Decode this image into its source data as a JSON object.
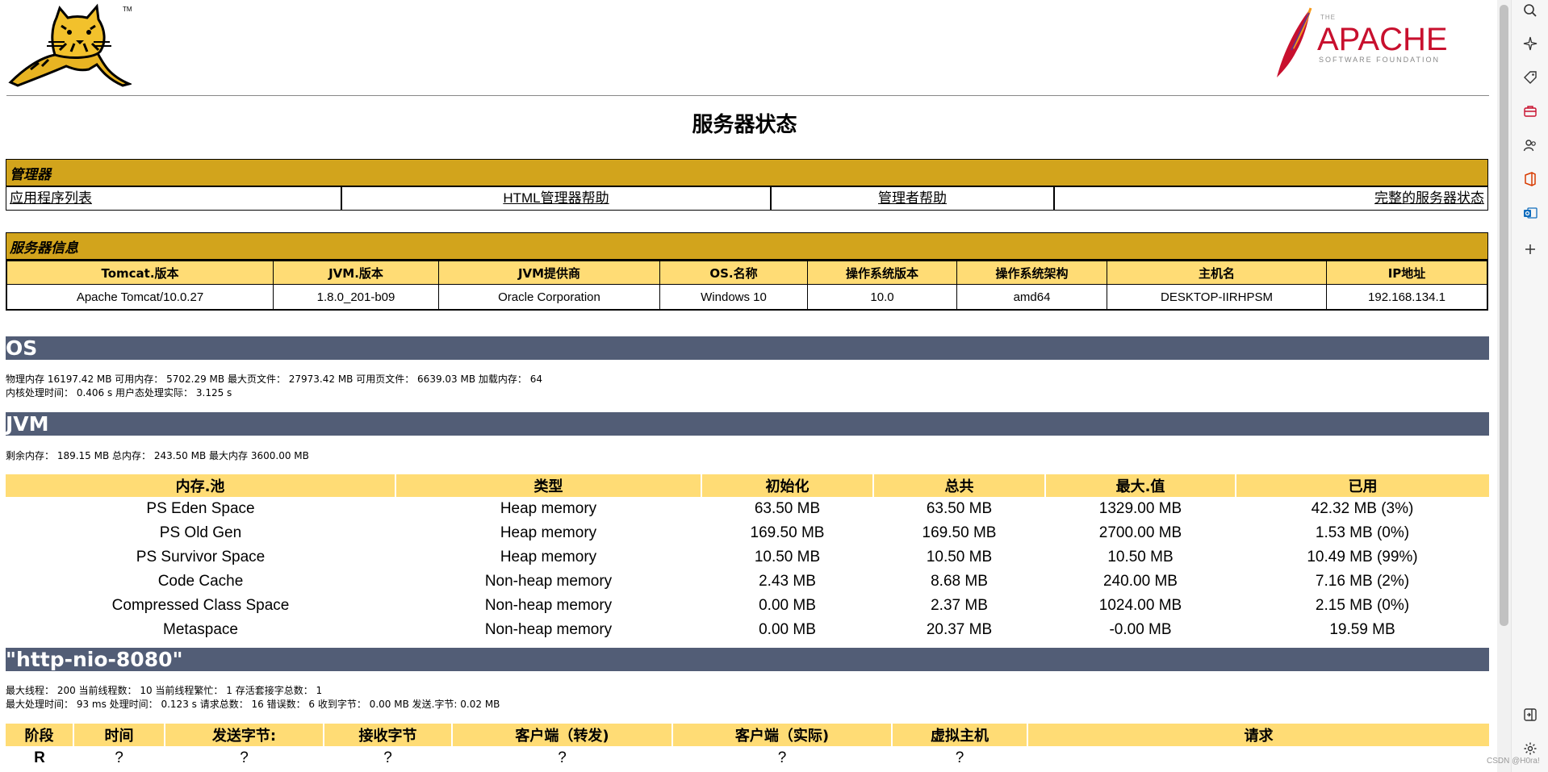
{
  "page_title": "服务器状态",
  "logos": {
    "apache_the": "THE",
    "apache_name": "APACHE",
    "apache_sub": "SOFTWARE FOUNDATION",
    "tomcat_tm": "TM"
  },
  "manager": {
    "header": "管理器",
    "links": [
      "应用程序列表",
      "HTML管理器帮助",
      "管理者帮助",
      "完整的服务器状态"
    ]
  },
  "server_info": {
    "header": "服务器信息",
    "columns": [
      "Tomcat.版本",
      "JVM.版本",
      "JVM提供商",
      "OS.名称",
      "操作系统版本",
      "操作系统架构",
      "主机名",
      "IP地址"
    ],
    "values": [
      "Apache Tomcat/10.0.27",
      "1.8.0_201-b09",
      "Oracle Corporation",
      "Windows 10",
      "10.0",
      "amd64",
      "DESKTOP-IIRHPSM",
      "192.168.134.1"
    ]
  },
  "os": {
    "title": "OS",
    "line1": "物理内存 16197.42 MB 可用内存： 5702.29 MB 最大页文件： 27973.42 MB 可用页文件： 6639.03 MB 加载内存： 64",
    "line2": "内核处理时间： 0.406 s 用户态处理实际： 3.125 s"
  },
  "jvm": {
    "title": "JVM",
    "line1": "剩余内存： 189.15 MB 总内存： 243.50 MB 最大内存 3600.00 MB",
    "columns": [
      "内存.池",
      "类型",
      "初始化",
      "总共",
      "最大.值",
      "已用"
    ],
    "rows": [
      [
        "PS Eden Space",
        "Heap memory",
        "63.50 MB",
        "63.50 MB",
        "1329.00 MB",
        "42.32 MB (3%)"
      ],
      [
        "PS Old Gen",
        "Heap memory",
        "169.50 MB",
        "169.50 MB",
        "2700.00 MB",
        "1.53 MB (0%)"
      ],
      [
        "PS Survivor Space",
        "Heap memory",
        "10.50 MB",
        "10.50 MB",
        "10.50 MB",
        "10.49 MB (99%)"
      ],
      [
        "Code Cache",
        "Non-heap memory",
        "2.43 MB",
        "8.68 MB",
        "240.00 MB",
        "7.16 MB (2%)"
      ],
      [
        "Compressed Class Space",
        "Non-heap memory",
        "0.00 MB",
        "2.37 MB",
        "1024.00 MB",
        "2.15 MB (0%)"
      ],
      [
        "Metaspace",
        "Non-heap memory",
        "0.00 MB",
        "20.37 MB",
        "-0.00 MB",
        "19.59 MB"
      ]
    ]
  },
  "connector": {
    "title": "\"http-nio-8080\"",
    "line1": "最大线程： 200 当前线程数： 10 当前线程繁忙： 1 存活套接字总数： 1",
    "line2": "最大处理时间： 93 ms 处理时间： 0.123 s 请求总数： 16 错误数： 6 收到字节： 0.00 MB 发送.字节: 0.02 MB",
    "columns": [
      "阶段",
      "时间",
      "发送字节:",
      "接收字节",
      "客户端（转发)",
      "客户端（实际)",
      "虚拟主机",
      "请求"
    ],
    "rows": [
      [
        "R",
        "?",
        "?",
        "?",
        "?",
        "?",
        "?",
        ""
      ]
    ]
  },
  "watermark": "CSDN @H0ra!",
  "colors": {
    "gold_header": "#D2A41C",
    "light_gold": "#FFDC75",
    "section_bar": "#525D76",
    "apache_red": "#C8102E"
  },
  "sidebar_icons": [
    "search-icon",
    "sparkle-icon",
    "tag-icon",
    "briefcase-icon",
    "people-icon",
    "office-icon",
    "outlook-icon",
    "plus-icon",
    "sidebar-toggle-icon",
    "settings-icon"
  ]
}
